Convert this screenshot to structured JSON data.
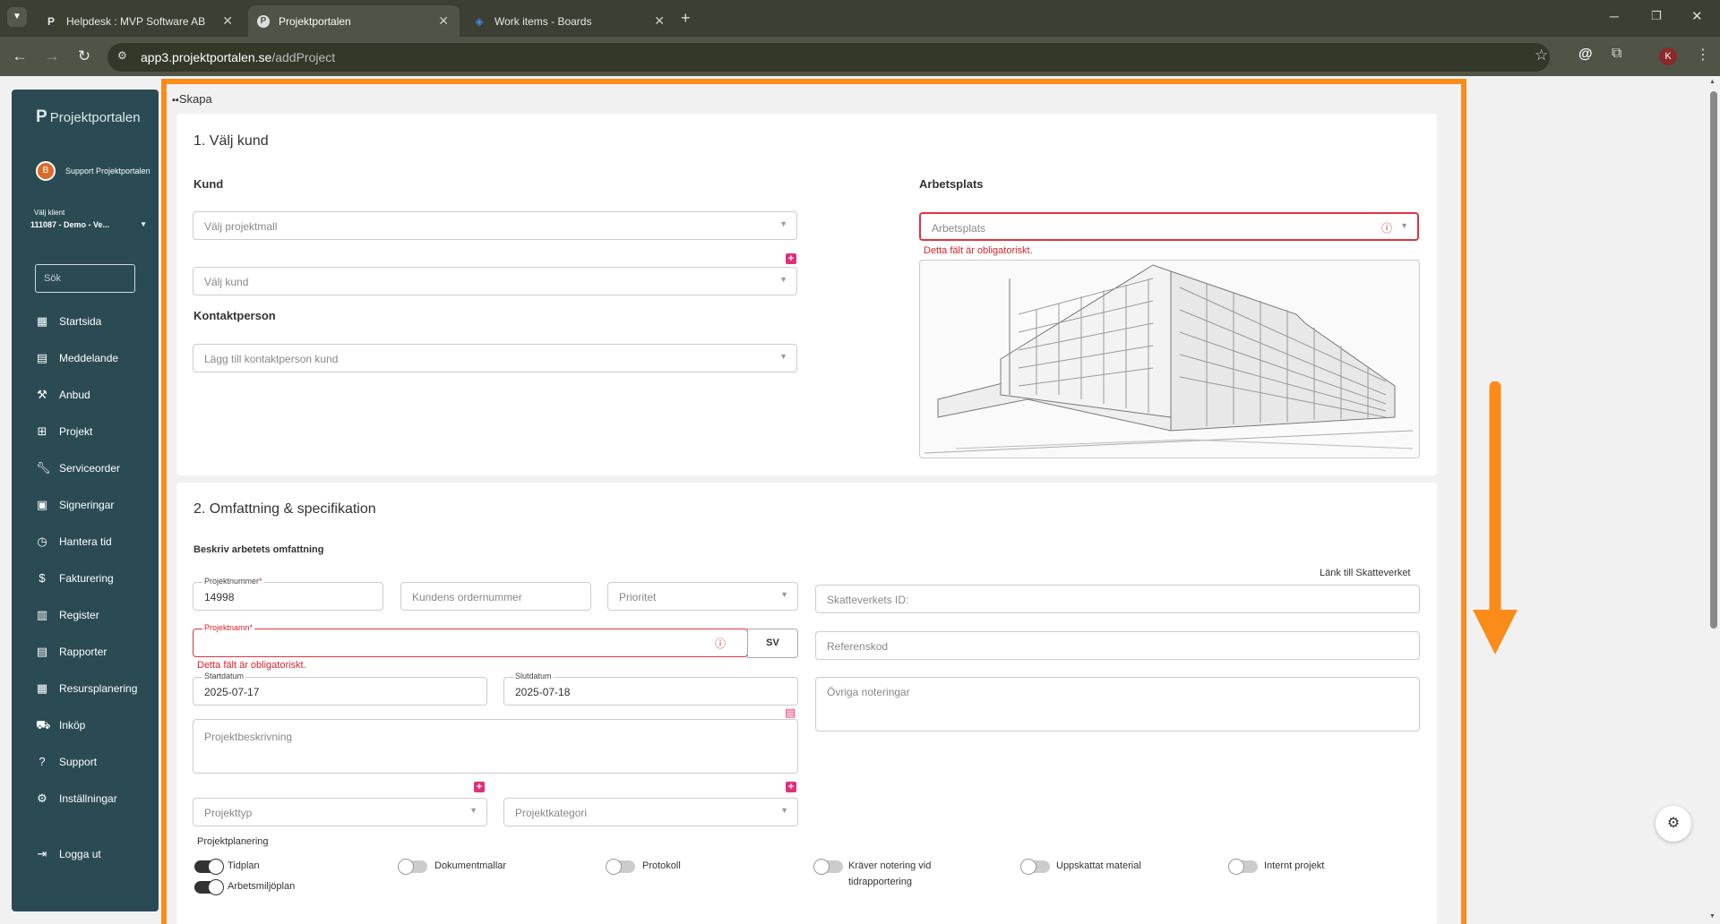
{
  "browser": {
    "tabs": [
      {
        "label": "Helpdesk : MVP Software AB",
        "icon": "P"
      },
      {
        "label": "Projektportalen",
        "icon": "P"
      },
      {
        "label": "Work items - Boards",
        "icon": "azure-devops-icon"
      }
    ],
    "url_host": "app3.projektportalen.se",
    "url_path": "/addProject",
    "profile_initial": "K"
  },
  "sidebar": {
    "logo": "Projektportalen",
    "user": "Support Projektportalen",
    "user_initial": "B",
    "client_label": "Välj klient",
    "client_value": "111087 - Demo - Ve...",
    "search_placeholder": "Sök",
    "items": [
      {
        "label": "Startsida",
        "icon": "dashboard-icon"
      },
      {
        "label": "Meddelande",
        "icon": "message-icon"
      },
      {
        "label": "Anbud",
        "icon": "gavel-icon"
      },
      {
        "label": "Projekt",
        "icon": "grid-icon"
      },
      {
        "label": "Serviceorder",
        "icon": "wrench-icon"
      },
      {
        "label": "Signeringar",
        "icon": "document-icon"
      },
      {
        "label": "Hantera tid",
        "icon": "clock-icon"
      },
      {
        "label": "Fakturering",
        "icon": "dollar-icon"
      },
      {
        "label": "Register",
        "icon": "register-icon"
      },
      {
        "label": "Rapporter",
        "icon": "report-icon"
      },
      {
        "label": "Resursplanering",
        "icon": "calendar-icon"
      },
      {
        "label": "Inköp",
        "icon": "cart-icon"
      },
      {
        "label": "Support",
        "icon": "help-icon"
      },
      {
        "label": "Inställningar",
        "icon": "gear-icon"
      }
    ],
    "logout": "Logga ut"
  },
  "breadcrumb": "Skapa",
  "section1": {
    "title": "1. Välj kund",
    "kund_label": "Kund",
    "projektmall_placeholder": "Välj projektmall",
    "kund_placeholder": "Välj kund",
    "kontakt_label": "Kontaktperson",
    "kontakt_placeholder": "Lägg till kontaktperson kund",
    "arbetsplats_label": "Arbetsplats",
    "arbetsplats_placeholder": "Arbetsplats",
    "arbetsplats_error": "Detta fält är obligatoriskt."
  },
  "section2": {
    "title": "2. Omfattning & specifikation",
    "subtitle": "Beskriv arbetets omfattning",
    "skatteverket_link": "Länk till Skatteverket",
    "projektnummer_label": "Projektnummer",
    "projektnummer_value": "14998",
    "ordernummer_placeholder": "Kundens ordernummer",
    "prioritet_placeholder": "Prioritet",
    "skatteverket_placeholder": "Skatteverkets ID:",
    "projektnamn_label": "Projektnamn",
    "projektnamn_error": "Detta fält är obligatoriskt.",
    "lang_button": "SV",
    "referenskod_placeholder": "Referenskod",
    "startdatum_label": "Startdatum",
    "startdatum_value": "2025-07-17",
    "slutdatum_label": "Slutdatum",
    "slutdatum_value": "2025-07-18",
    "noteringar_placeholder": "Övriga noteringar",
    "beskrivning_placeholder": "Projektbeskrivning",
    "projekttyp_placeholder": "Projekttyp",
    "projektkategori_placeholder": "Projektkategori",
    "planering_label": "Projektplanering",
    "toggles": [
      {
        "label": "Tidplan",
        "on": true
      },
      {
        "label": "Arbetsmiljöplan",
        "on": true
      },
      {
        "label": "Dokumentmallar",
        "on": false
      },
      {
        "label": "Protokoll",
        "on": false
      },
      {
        "label": "Kräver notering vid tidrapportering",
        "on": false
      },
      {
        "label": "Uppskattat material",
        "on": false
      },
      {
        "label": "Internt projekt",
        "on": false
      }
    ]
  },
  "colors": {
    "annotation": "#fb8c1a",
    "sidebar": "#2a4b54",
    "error": "#d8232a",
    "pink": "#e0307a"
  }
}
